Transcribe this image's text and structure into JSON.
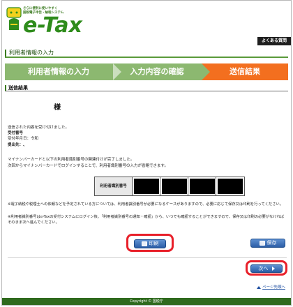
{
  "header": {
    "tagline_line1": "さらに便利に使いやすく",
    "tagline_line2": "国税電子申告・納税システム",
    "logo_text": "e-Tax",
    "faq_label": "よくある質問"
  },
  "page_title": "利用者情報の入力",
  "steps": [
    {
      "label": "利用者情報の入力"
    },
    {
      "label": "入力内容の確認"
    },
    {
      "label": "送信結果"
    }
  ],
  "section_title": "送信結果",
  "recipient_suffix": "様",
  "result": {
    "received_message": "送信された内容を受け付けました。",
    "receipt_number_label": "受付番号",
    "received_at_label": "受付年月日：令和",
    "submitter_label": "提出先：、"
  },
  "mynumber": {
    "linked_message": "マイナンバーカードと以下の利用者識別番号の関連付けが完了しました。",
    "next_time_message": "次回からマイナンバーカードでログインすることで、利用者識別番号の入力が省略できます。",
    "id_label": "利用者識別番号"
  },
  "notes": [
    "※電子納税や税理士への依頼などを予定されている方については、利用者識別番号が必要になるケースがありますので、必要に応じて保存又は印刷を行ってください。",
    "※利用者識別番号はe-Taxの受付システムにログイン後、「利用者識別番号の通知・確認」から、いつでも確認することができますので、保存又は印刷の必要がなければそのまま次へ進んでください。"
  ],
  "buttons": {
    "print": "印刷",
    "save": "保存",
    "next": "次へ"
  },
  "page_top_link": "ページ先頭へ",
  "footer": "Copyright © 国税庁",
  "colors": {
    "accent_green": "#2f8c1c",
    "step_inactive": "#8cb870",
    "step_active": "#f36f1f",
    "highlight_red": "#e8202a",
    "button_blue": "#2c5ea6"
  }
}
